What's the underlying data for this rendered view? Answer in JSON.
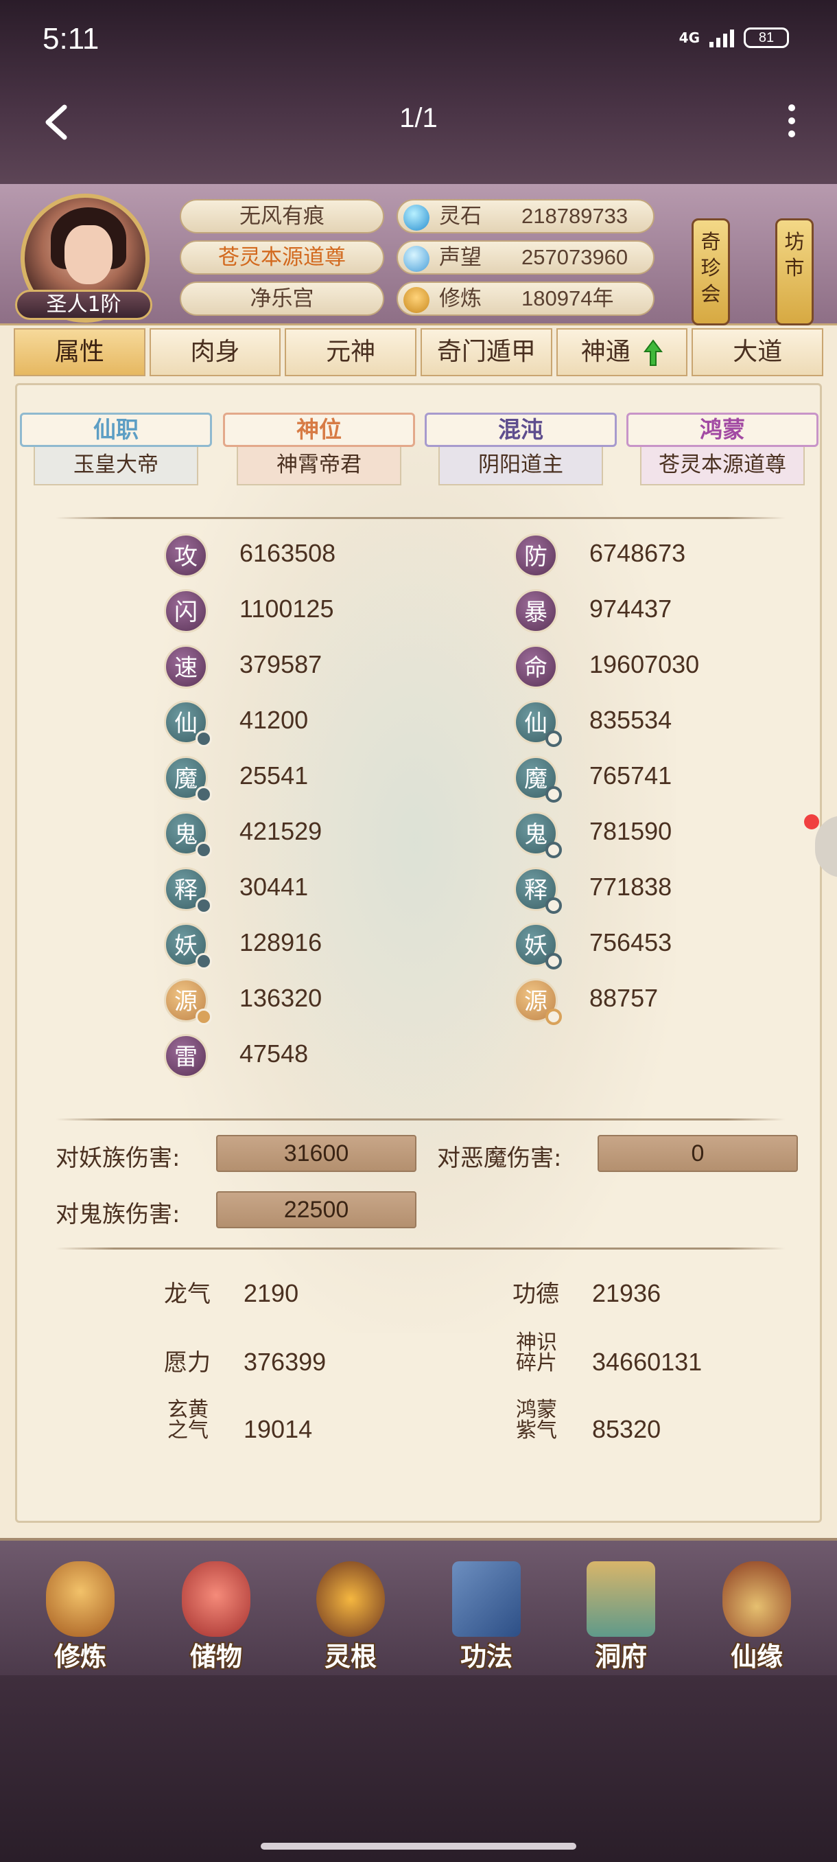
{
  "status": {
    "time": "5:11",
    "network": "4G",
    "battery": "81"
  },
  "appbar": {
    "page_indicator": "1/1"
  },
  "player": {
    "rank": "圣人1阶",
    "name": "无风有痕",
    "title": "苍灵本源道尊",
    "sect": "净乐宫"
  },
  "resources": [
    {
      "icon": "spirit-stone-icon",
      "label": "灵石",
      "value": "218789733"
    },
    {
      "icon": "fame-drop-icon",
      "label": "声望",
      "value": "257073960"
    },
    {
      "icon": "meditation-icon",
      "label": "修炼",
      "value": "180974年"
    }
  ],
  "signs": {
    "treasure": "奇珍会",
    "market": "坊市"
  },
  "tabs": [
    "属性",
    "肉身",
    "元神",
    "奇门遁甲",
    "神通",
    "大道"
  ],
  "ranks": [
    {
      "head": "仙职",
      "value": "玉皇大帝"
    },
    {
      "head": "神位",
      "value": "神霄帝君"
    },
    {
      "head": "混沌",
      "value": "阴阳道主"
    },
    {
      "head": "鸿蒙",
      "value": "苍灵本源道尊"
    }
  ],
  "stats_left": [
    {
      "char": "攻",
      "value": "6163508"
    },
    {
      "char": "闪",
      "value": "1100125"
    },
    {
      "char": "速",
      "value": "379587"
    },
    {
      "char": "仙",
      "value": "41200"
    },
    {
      "char": "魔",
      "value": "25541"
    },
    {
      "char": "鬼",
      "value": "421529"
    },
    {
      "char": "释",
      "value": "30441"
    },
    {
      "char": "妖",
      "value": "128916"
    },
    {
      "char": "源",
      "value": "136320"
    },
    {
      "char": "雷",
      "value": "47548"
    }
  ],
  "stats_right": [
    {
      "char": "防",
      "value": "6748673"
    },
    {
      "char": "暴",
      "value": "974437"
    },
    {
      "char": "命",
      "value": "19607030"
    },
    {
      "char": "仙",
      "value": "835534"
    },
    {
      "char": "魔",
      "value": "765741"
    },
    {
      "char": "鬼",
      "value": "781590"
    },
    {
      "char": "释",
      "value": "771838"
    },
    {
      "char": "妖",
      "value": "756453"
    },
    {
      "char": "源",
      "value": "88757"
    }
  ],
  "damage": {
    "demon_race_label": "对妖族伤害:",
    "demon_race_value": "31600",
    "evil_label": "对恶魔伤害:",
    "evil_value": "0",
    "ghost_label": "对鬼族伤害:",
    "ghost_value": "22500"
  },
  "misc": {
    "dragon_qi_label": "龙气",
    "dragon_qi_value": "2190",
    "merit_label": "功德",
    "merit_value": "21936",
    "wish_label": "愿力",
    "wish_value": "376399",
    "soul_shard_label": "神识碎片",
    "soul_shard_value": "34660131",
    "xuanhuang_label": "玄黄之气",
    "xuanhuang_value": "19014",
    "hongmeng_label": "鸿蒙紫气",
    "hongmeng_value": "85320"
  },
  "bottom_nav": [
    "修炼",
    "储物",
    "灵根",
    "功法",
    "洞府",
    "仙缘"
  ]
}
